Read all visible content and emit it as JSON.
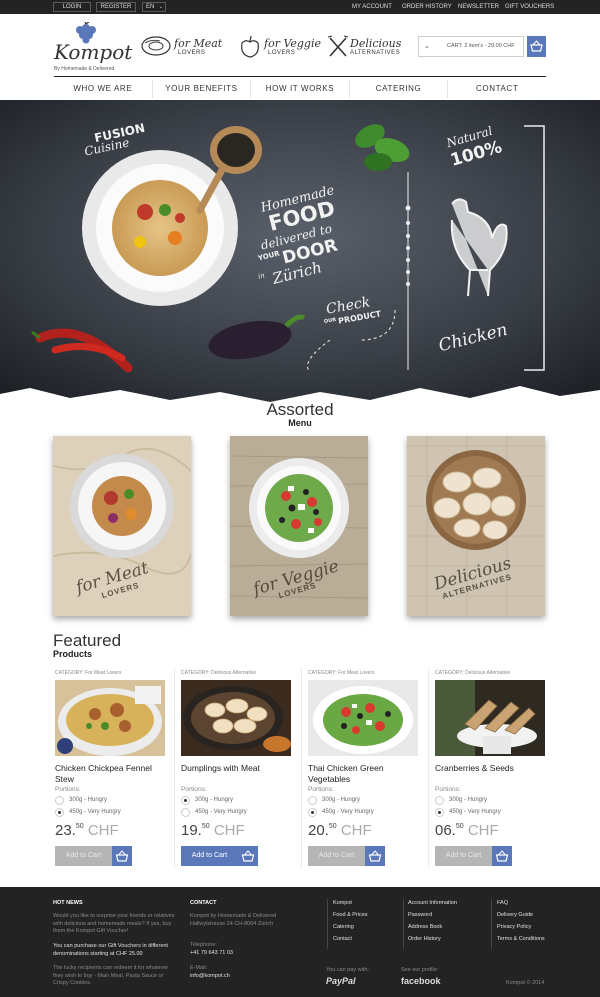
{
  "topbar": {
    "login": "LOGIN",
    "register": "REGISTER",
    "lang": "EN",
    "links": [
      "MY ACCOUNT",
      "ORDER HISTORY",
      "NEWSLETTER",
      "GIFT VOUCHERS"
    ]
  },
  "header": {
    "logo": "Kompot",
    "tagline": "By Homemade & Delivered",
    "categories": [
      {
        "script": "for Meat",
        "sub": "LOVERS"
      },
      {
        "script": "for Veggie",
        "sub": "LOVERS"
      },
      {
        "script": "Delicious",
        "sub": "ALTERNATIVES"
      }
    ],
    "cart_text": "CART: 2 item's - 29.00 CHF"
  },
  "nav": [
    "WHO WE ARE",
    "YOUR BENEFITS",
    "HOW IT WORKS",
    "CATERING",
    "CONTACT"
  ],
  "hero": {
    "fusion": "FUSION",
    "cuisine": "Cuisine",
    "homemade": "Homemade",
    "food": "FOOD",
    "delivered_to": "delivered to",
    "your": "YOUR",
    "door": "DOOR",
    "in": "in",
    "zurich": "Zürich",
    "check": "Check",
    "our": "OUR",
    "product": "PRODUCT",
    "natural": "Natural",
    "natural_pct": "100%",
    "chicken": "Chicken"
  },
  "assorted": {
    "title": "Assorted",
    "subtitle": "Menu",
    "cards": [
      {
        "script": "for Meat",
        "sub": "LOVERS"
      },
      {
        "script": "for Veggie",
        "sub": "LOVERS"
      },
      {
        "script": "Delicious",
        "sub": "ALTERNATIVES"
      }
    ]
  },
  "featured": {
    "title": "Featured",
    "subtitle": "Products",
    "portions_label": "Portions:",
    "options": [
      "300g - Hungry",
      "450g - Very Hungry"
    ],
    "add_label": "Add to Cart",
    "currency": "CHF",
    "products": [
      {
        "category": "CATEGORY: For Meat Lovers",
        "name": "Chicken Chickpea Fennel Stew",
        "price_main": "23.",
        "price_cents": "50",
        "selected": 1,
        "add_active": false
      },
      {
        "category": "CATEGORY: Delicious Alternative",
        "name": "Dumplings with Meat",
        "price_main": "19.",
        "price_cents": "50",
        "selected": 0,
        "add_active": true
      },
      {
        "category": "CATEGORY: For Meat Lovers",
        "name": "Thai Chicken Green Vegetables",
        "price_main": "20.",
        "price_cents": "50",
        "selected": 1,
        "add_active": false
      },
      {
        "category": "CATEGORY: Delicious Alternative",
        "name": "Cranberries & Seeds",
        "price_main": "06.",
        "price_cents": "50",
        "selected": 1,
        "add_active": false
      }
    ]
  },
  "footer": {
    "hot_news_title": "HOT NEWS",
    "hot_news_1": "Would you like to surprise your friends or relatives with delicious and homemade meals? If yes, buy them the Kompot Gift Voucher!",
    "hot_news_2": "You can purchase our Gift Vouchers in different denominations starting at CHF 25.00",
    "hot_news_3": "The lucky recipients can redeem it for whatever they wish to buy - Main Meal, Pasta Sauce or Crispy Cookies.",
    "contact_title": "CONTACT",
    "address": "Kompot by Homemade & Delivered Hallwylstrasse 24 CH-8004 Zürich",
    "telephone_label": "Telephone:",
    "telephone": "+41 79 643 71 03",
    "email_label": "E-Mail:",
    "email": "info@kompot.ch",
    "links_col1": [
      "Kompot",
      "Food & Prices",
      "Catering",
      "Contact"
    ],
    "links_col2": [
      "Account Information",
      "Password",
      "Address Book",
      "Order History"
    ],
    "links_col3": [
      "FAQ",
      "Delivery Guide",
      "Privacy Policy",
      "Terms & Conditions"
    ],
    "pay_label": "You can pay with:",
    "paypal": "PayPal",
    "profile_label": "See our profile:",
    "facebook": "facebook",
    "copyright": "Kompot © 2014"
  },
  "colors": {
    "accent": "#5a78b9",
    "dark": "#232323"
  }
}
